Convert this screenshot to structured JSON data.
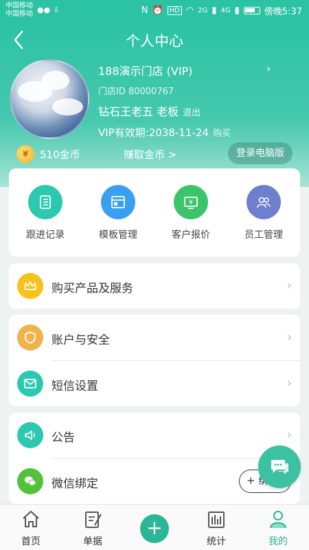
{
  "status_bar": {
    "carrier_1": "中国移动",
    "carrier_2": "中国移动",
    "network_1": "2G",
    "network_2": "4G",
    "time": "傍晚5:37"
  },
  "header": {
    "title": "个人中心",
    "store_name": "188演示门店 (VIP)",
    "store_id": "门店ID 80000767",
    "owner": "钻石王老五 老板",
    "logout": "退出",
    "vip_expiry": "VIP有效期:2038-11-24",
    "buy": "购买",
    "coin_symbol": "¥",
    "coins": "510金币",
    "earn_coins": "赚取金币 >",
    "pc_login": "登录电脑版"
  },
  "quick_actions": [
    {
      "label": "跟进记录",
      "icon": "follow-record-icon",
      "color": "#2cc9b0"
    },
    {
      "label": "模板管理",
      "icon": "template-icon",
      "color": "#3a9ff0"
    },
    {
      "label": "客户报价",
      "icon": "quote-icon",
      "color": "#3cc46b"
    },
    {
      "label": "员工管理",
      "icon": "staff-icon",
      "color": "#6e7fce"
    }
  ],
  "menu": {
    "buy_products": "购买产品及服务",
    "account_security": "账户与安全",
    "sms_settings": "短信设置",
    "announcement": "公告",
    "wechat_bind": "微信绑定",
    "bind_button": "+ 绑定"
  },
  "tabbar": [
    {
      "label": "首页",
      "icon": "home-icon"
    },
    {
      "label": "单据",
      "icon": "document-icon"
    },
    {
      "label": "统计",
      "icon": "stats-icon"
    },
    {
      "label": "我的",
      "icon": "profile-icon"
    }
  ],
  "colors": {
    "primary": "#2cc2a4",
    "active_tab": "#2cb597"
  }
}
